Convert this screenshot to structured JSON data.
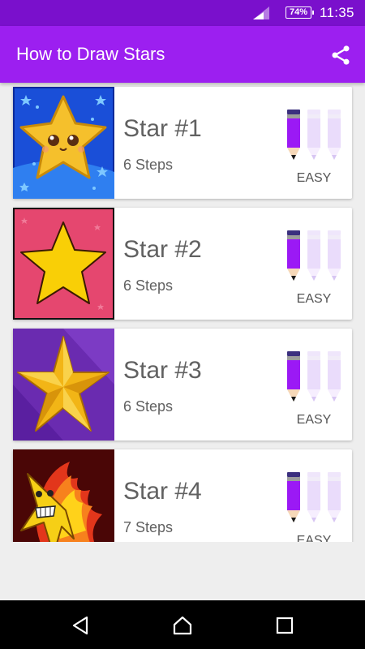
{
  "status_bar": {
    "battery": "74%",
    "time": "11:35"
  },
  "app_bar": {
    "title": "How to Draw Stars",
    "share_icon": "share-icon"
  },
  "items": [
    {
      "name": "Star #1",
      "steps": "6 Steps",
      "level": "EASY",
      "difficulty": 1,
      "pencils_total": 3
    },
    {
      "name": "Star #2",
      "steps": "6 Steps",
      "level": "EASY",
      "difficulty": 1,
      "pencils_total": 3
    },
    {
      "name": "Star #3",
      "steps": "6 Steps",
      "level": "EASY",
      "difficulty": 1,
      "pencils_total": 3
    },
    {
      "name": "Star #4",
      "steps": "7 Steps",
      "level": "EASY",
      "difficulty": 1,
      "pencils_total": 3
    }
  ],
  "nav_bar": {
    "icons": [
      "back-icon",
      "home-icon",
      "recents-icon"
    ]
  },
  "colors": {
    "status_bar": "#7a10cc",
    "app_bar": "#9c1ff0",
    "pencil_active": "#9b19f5",
    "pencil_inactive": "#eadcfb"
  }
}
